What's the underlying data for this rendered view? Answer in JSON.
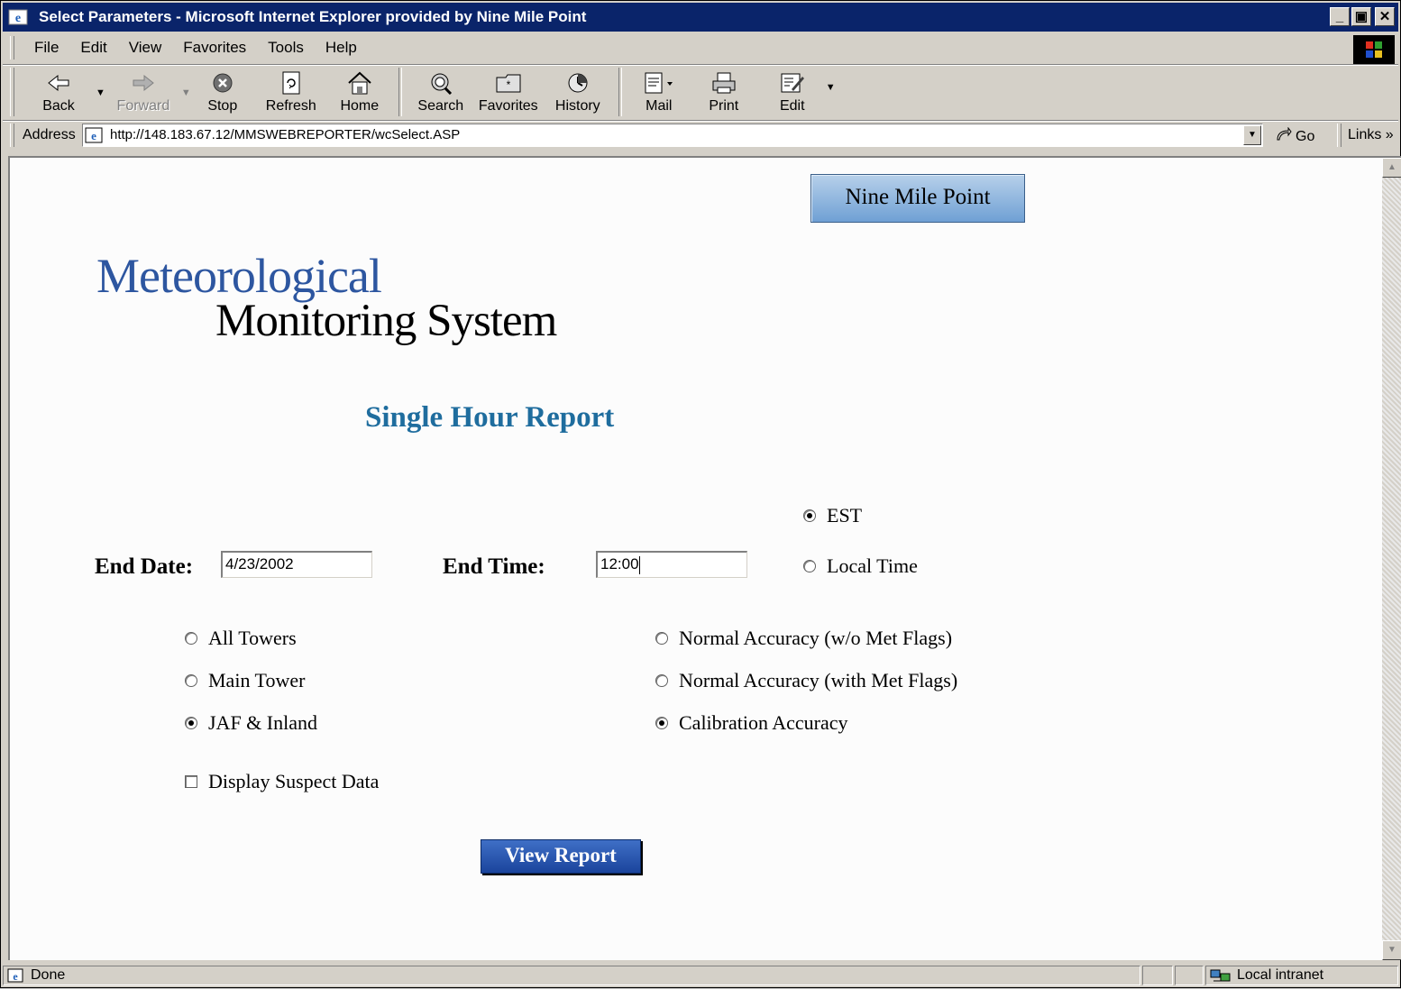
{
  "window": {
    "title": "Select Parameters - Microsoft Internet Explorer provided by Nine Mile Point"
  },
  "menu": {
    "items": [
      {
        "label": "File"
      },
      {
        "label": "Edit"
      },
      {
        "label": "View"
      },
      {
        "label": "Favorites"
      },
      {
        "label": "Tools"
      },
      {
        "label": "Help"
      }
    ]
  },
  "toolbar": {
    "back": "Back",
    "forward": "Forward",
    "stop": "Stop",
    "refresh": "Refresh",
    "home": "Home",
    "search": "Search",
    "favorites": "Favorites",
    "history": "History",
    "mail": "Mail",
    "print": "Print",
    "edit": "Edit"
  },
  "address": {
    "label": "Address",
    "url": "http://148.183.67.12/MMSWEBREPORTER/wcSelect.ASP",
    "go": "Go",
    "links": "Links »"
  },
  "page": {
    "site_button": "Nine Mile Point",
    "brand_line1": "Meteorological",
    "brand_line2": "Monitoring System",
    "report_title": "Single Hour Report",
    "end_date_label": "End Date:",
    "end_date_value": "4/23/2002",
    "end_time_label": "End Time:",
    "end_time_value": "12:00",
    "time_zone": {
      "est": "EST",
      "local": "Local Time",
      "selected": "EST"
    },
    "towers": {
      "all": "All Towers",
      "main": "Main Tower",
      "jaf": "JAF & Inland",
      "selected": "JAF & Inland"
    },
    "accuracy": {
      "normal_no_flags": "Normal Accuracy (w/o Met Flags)",
      "normal_flags": "Normal Accuracy (with Met Flags)",
      "calibration": "Calibration Accuracy",
      "selected": "Calibration Accuracy"
    },
    "suspect_data_label": "Display Suspect Data",
    "suspect_data_checked": false,
    "view_report": "View Report"
  },
  "status": {
    "text": "Done",
    "zone": "Local intranet"
  },
  "colors": {
    "titlebar": "#0a246a",
    "brand_blue": "#2d56a0",
    "report_title": "#1f6d9e",
    "view_button": "#1b449c"
  }
}
